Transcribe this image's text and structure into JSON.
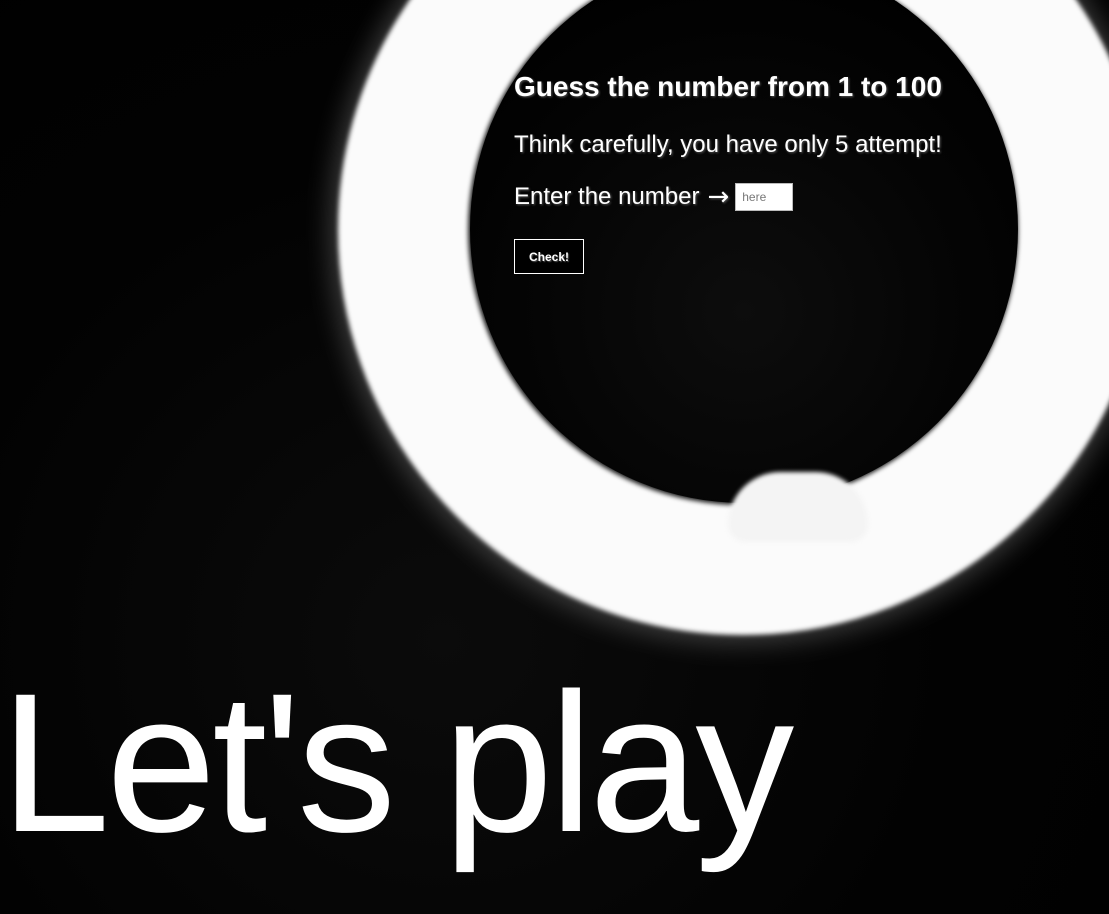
{
  "game": {
    "title": "Guess the number from 1 to 100",
    "subtitle": "Think carefully, you have only 5 attempt!",
    "entry_label": "Enter the number",
    "entry_arrow": "→",
    "input_placeholder": "here",
    "input_value": "",
    "check_label": "Check!"
  },
  "hero": {
    "text": "Let's play"
  },
  "colors": {
    "background": "#000000",
    "text": "#ffffff",
    "ring_light": "#fbfbfb"
  }
}
